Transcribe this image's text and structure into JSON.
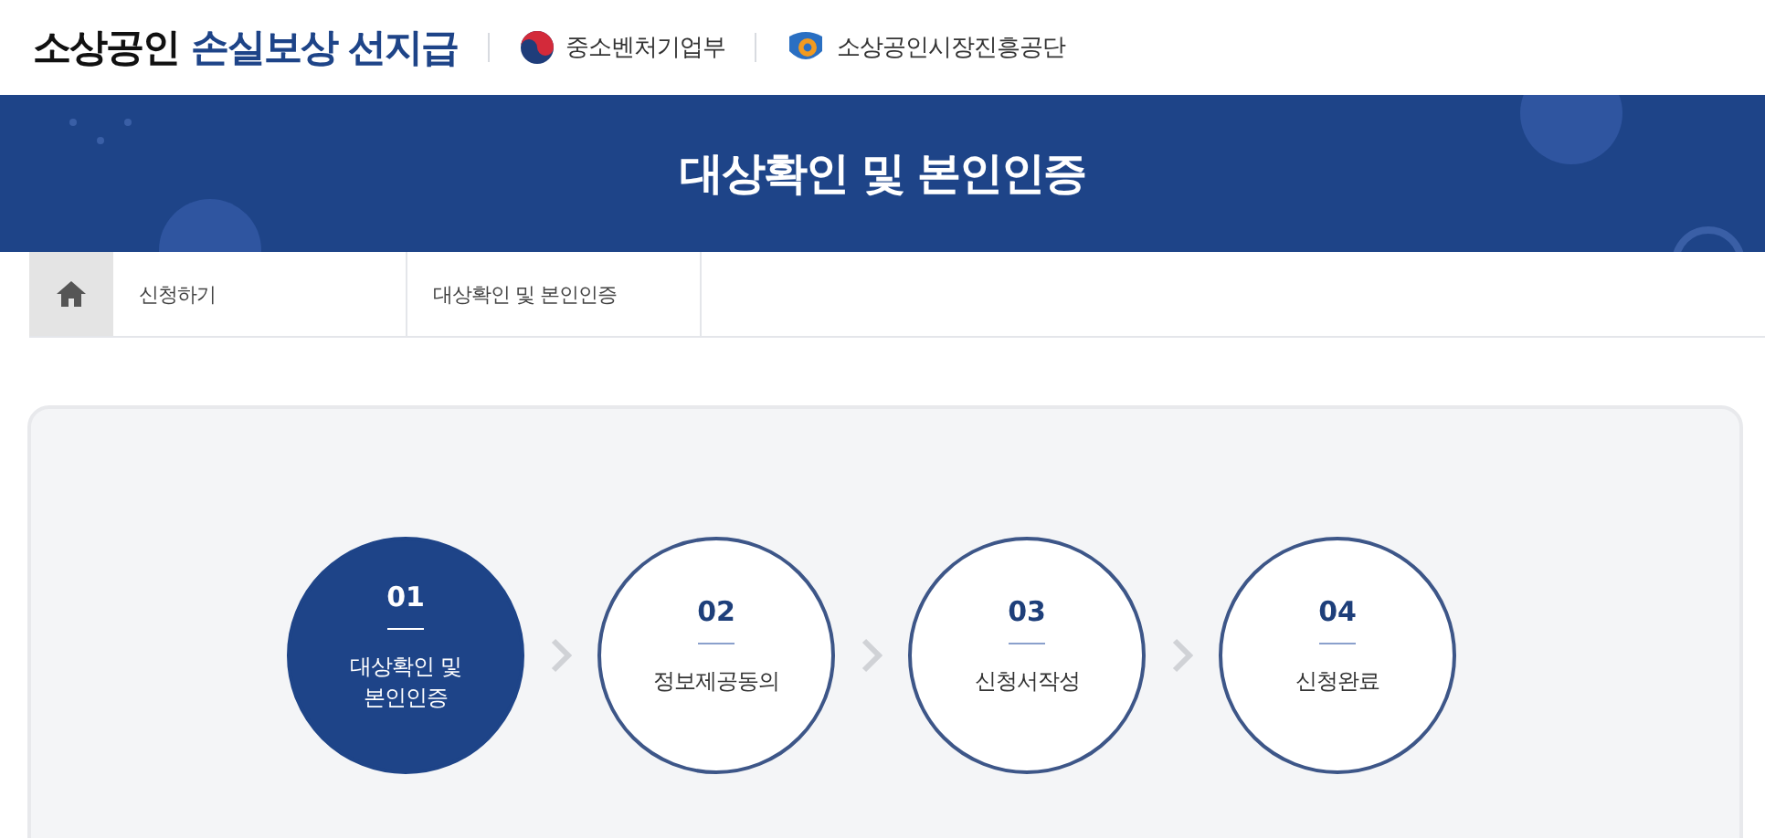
{
  "header": {
    "title_plain": "소상공인",
    "title_accent": "손실보상 선지급",
    "ministry": "중소벤처기업부",
    "agency": "소상공인시장진흥공단"
  },
  "banner": {
    "title": "대상확인 및 본인인증"
  },
  "breadcrumb": {
    "items": [
      "신청하기",
      "대상확인 및 본인인증"
    ]
  },
  "steps": [
    {
      "number": "01",
      "label_lines": [
        "대상확인 및",
        "본인인증"
      ],
      "selected": true
    },
    {
      "number": "02",
      "label_lines": [
        "정보제공동의"
      ],
      "selected": false
    },
    {
      "number": "03",
      "label_lines": [
        "신청서작성"
      ],
      "selected": false
    },
    {
      "number": "04",
      "label_lines": [
        "신청완료"
      ],
      "selected": false
    }
  ]
}
